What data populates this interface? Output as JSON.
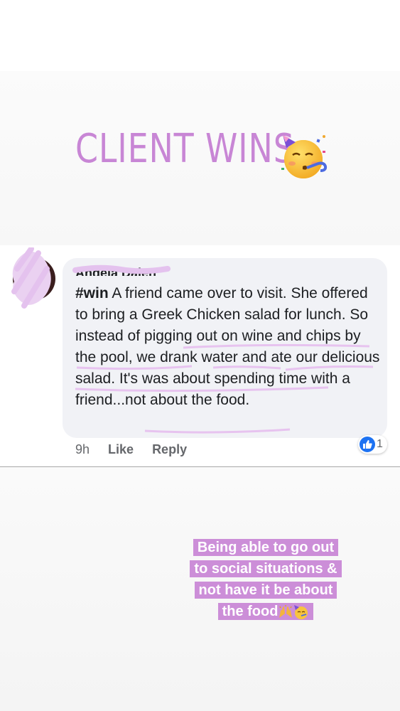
{
  "header": {
    "title": "CLIENT WINS",
    "title_color": "#c886d5",
    "emoji": "party-face-icon"
  },
  "comment": {
    "author": "Angela Dalen",
    "hashtag": "#win",
    "text": "A friend came over to visit.  She offered to bring a Greek Chicken salad for lunch.  So instead of pigging out on wine and chips by the pool, we drank water and ate our delicious salad. It's was about spending time with a friend...not about the food.",
    "time": "9h",
    "like_label": "Like",
    "reply_label": "Reply",
    "reaction_count": "1",
    "bubble_color": "#f1f2f6",
    "highlight_color": "#e7c3ef"
  },
  "caption": {
    "lines": [
      "Being able to go out",
      "to social situations &",
      "not have it be about",
      "the food"
    ],
    "emojis": [
      "raised-hands-icon",
      "party-face-icon"
    ],
    "background": "#cc8ed8"
  }
}
